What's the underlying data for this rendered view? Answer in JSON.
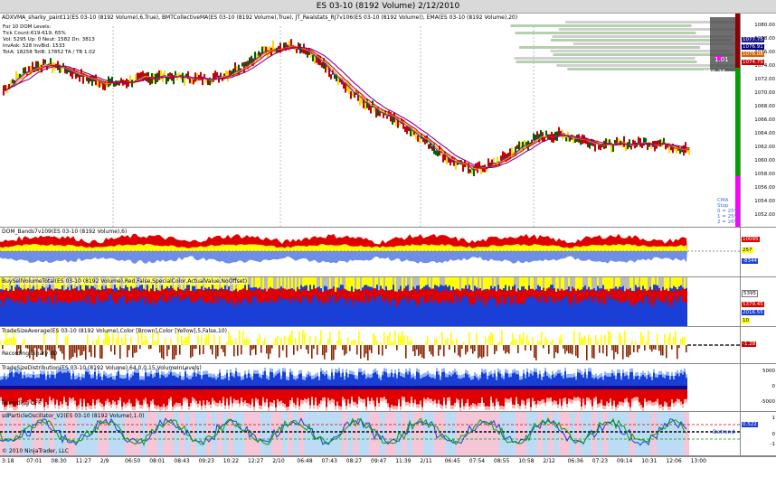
{
  "window": {
    "title": "ES 03-10 (8192 Volume)  2/12/2010"
  },
  "panels": {
    "price": {
      "title": "ADXVMA_sharky_paint11(ES 03-10 (8192 Volume),6,True), BMTCollectiveMA(ES 03-10 (8192 Volume),True), JT_Realstats_RJ7v106(ES 03-10 (8192 Volume)), EMA(ES 03-10 (8192 Volume),20)",
      "info": [
        "For 10 DOM Levels:",
        "Tick Count:619-619; 65%",
        "Vol: 5295   Up: 0  Neut: 1582   Dn: 3813",
        "InvAsk: 528   InvBid: 1533",
        "TotA: 18258   TotB: 17852   TA / TB 1.02"
      ],
      "ticks": [
        "1080.00",
        "1078.00",
        "1076.00",
        "1074.00",
        "1072.00",
        "1070.00",
        "1068.00",
        "1066.00",
        "1064.00",
        "1062.00",
        "1060.00",
        "1058.00",
        "1056.00",
        "1054.00",
        "1052.00"
      ],
      "badges": [
        "1077.75",
        "1076.91",
        "1076.08",
        "1074.79"
      ],
      "overlay": [
        "1.01",
        "176.76"
      ],
      "cma": [
        "CMA Stop",
        "0 = 25**",
        "1 = 25**",
        "2 = 26**"
      ]
    },
    "dom": {
      "title": "DOM_Bands7v109(ES 03-10 (8192 Volume),6)",
      "badges": [
        "10095",
        "257",
        "-8344"
      ]
    },
    "buysell": {
      "title": "BuySellVolumeTotal(ES 03-10 (8192 Volume),Red,False,SpecialColor,ActualValue,NoOffset)",
      "badges": [
        "5395",
        "5379.45",
        "2016.55",
        "10"
      ]
    },
    "tsa": {
      "title": "TradeSizeAverage(ES 03-10 (8192 Volume),Color [Brown],Color [Yellow],5,False,10)",
      "recording": "Recording Binary KO",
      "badges": [
        "-1.28"
      ]
    },
    "tsd": {
      "title": "TradeSizeDistribution(ES 03-10 (8192 Volume),64,0,0,15,VolumeInLevels)",
      "recording": "Recording OFF",
      "ticks": [
        "5000",
        "0",
        "-5000"
      ]
    },
    "osc": {
      "title": "sdParticleOscillator_V2(ES 03-10 (8192 Volume),1.0)",
      "copyright": "© 2010 NinjaTrader, LLC",
      "note": "Detrend",
      "badges": [
        "0.522"
      ],
      "ticks": [
        "1",
        "0",
        "-1"
      ]
    }
  },
  "xaxis": {
    "labels": [
      "3:18",
      "07:01",
      "08:30",
      "11:27",
      "2/9",
      "06:50",
      "08:01",
      "08:43",
      "09:23",
      "10:22",
      "12:27",
      "2/10",
      "06:48",
      "07:43",
      "08:27",
      "09:47",
      "11:39",
      "2/11",
      "06:45",
      "07:54",
      "08:55",
      "10:58",
      "2/12",
      "06:36",
      "07:23",
      "09:14",
      "10:31",
      "12:06",
      "13:00"
    ]
  },
  "colors": {
    "up_bar": "#c40000",
    "down_bar": "#006000",
    "ema": "#8b008b",
    "red": "#e00000",
    "yellow": "#ffff00",
    "blue": "#1a3fd6"
  }
}
